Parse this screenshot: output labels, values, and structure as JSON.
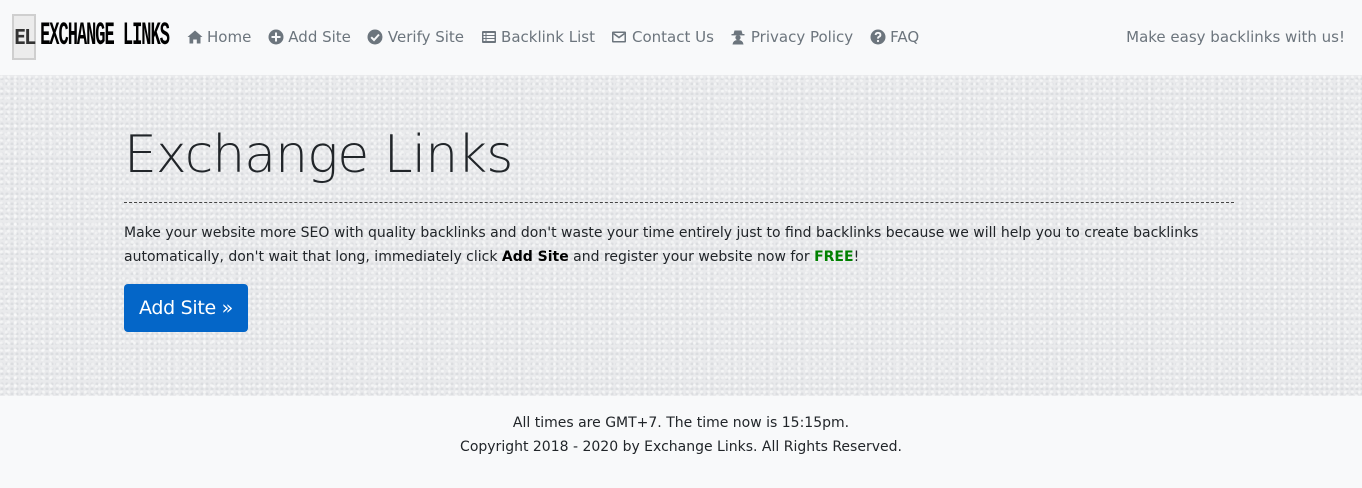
{
  "brand": {
    "logo_mark": "EL",
    "logo_text": "EXCHANGE LINKS"
  },
  "nav": {
    "items": [
      {
        "label": "Home",
        "icon": "home-icon"
      },
      {
        "label": "Add Site",
        "icon": "plus-circle-icon"
      },
      {
        "label": "Verify Site",
        "icon": "check-circle-icon"
      },
      {
        "label": "Backlink List",
        "icon": "list-icon"
      },
      {
        "label": "Contact Us",
        "icon": "envelope-icon"
      },
      {
        "label": "Privacy Policy",
        "icon": "user-secret-icon"
      },
      {
        "label": "FAQ",
        "icon": "question-circle-icon"
      }
    ],
    "tagline": "Make easy backlinks with us!"
  },
  "hero": {
    "title": "Exchange Links",
    "text_part1": "Make your website more SEO with quality backlinks and don't waste your time entirely just to find backlinks because we will help you to create backlinks automatically, don't wait that long, immediately click ",
    "text_bold": "Add Site",
    "text_part2": " and register your website now for ",
    "text_free": "FREE",
    "text_end": "!",
    "button_label": "Add Site »"
  },
  "footer": {
    "timezone_line": "All times are GMT+7. The time now is 15:15pm.",
    "copyright": "Copyright 2018 - 2020 by Exchange Links. All Rights Reserved."
  },
  "colors": {
    "primary_button": "#0466c8",
    "free_text": "#008000",
    "nav_text": "#6c757d"
  }
}
